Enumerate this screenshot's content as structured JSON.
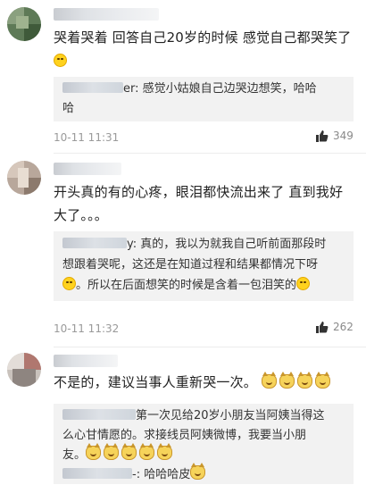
{
  "comments": [
    {
      "text_line1": "哭着哭着 回答自己20岁的时候 感觉自己都哭笑了",
      "reply_suffix": "er: 感觉小姑娘自己边哭边想笑，哈哈",
      "reply_line2": "哈",
      "time": "10-11 11:31",
      "likes": "349"
    },
    {
      "text_line1": "开头真的有的心疼，眼泪都快流出来了 直到我好",
      "text_line2": "大了。。。",
      "reply_line1_suffix": "y: 真的，我以为就我自己听前面那段时",
      "reply_line2": "想跟着哭呢，这还是在知道过程和结果都情况下呀",
      "reply_line3": "。所以在后面想笑的时候是含着一包泪笑的",
      "time": "10-11 11:32",
      "likes": "262"
    },
    {
      "text": "不是的，建议当事人重新哭一次。",
      "reply1_line1_suffix": "第一次见给20岁小朋友当阿姨当得这",
      "reply1_line2": "么心甘情愿的。求接线员阿姨微博，我要当小朋",
      "reply1_line3": "友。",
      "reply2_suffix": "-: 哈哈哈皮"
    }
  ],
  "icons": {
    "like": "thumbs-up-icon",
    "laugh": "laugh-emoji-icon",
    "cat": "cat-emoji-icon"
  }
}
